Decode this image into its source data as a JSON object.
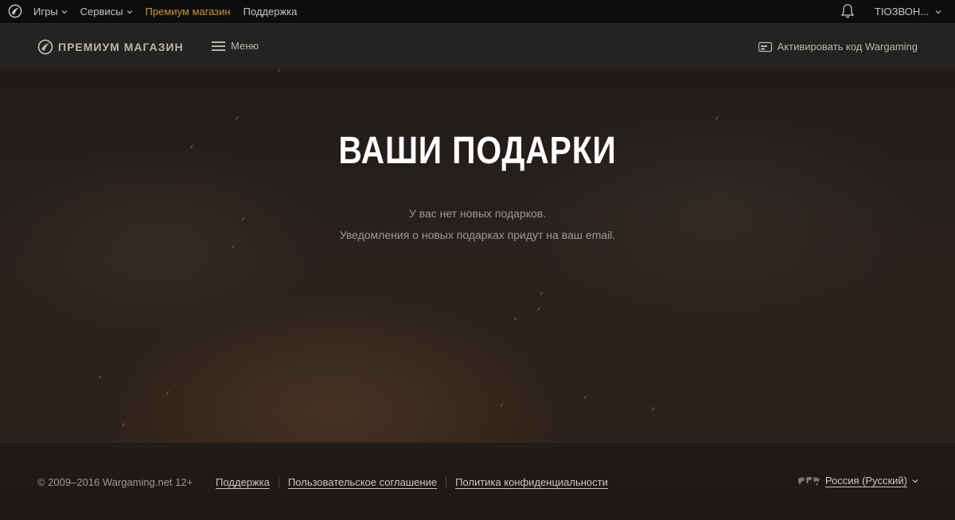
{
  "topbar": {
    "nav": [
      {
        "label": "Игры",
        "dropdown": true
      },
      {
        "label": "Сервисы",
        "dropdown": true
      },
      {
        "label": "Премиум магазин",
        "dropdown": false,
        "active": true
      },
      {
        "label": "Поддержка",
        "dropdown": false
      }
    ],
    "user": "ТІОЗВОН...",
    "icons": {
      "logo": "wargaming-logo-icon",
      "notifications": "bell-icon",
      "user_dropdown": "chevron-down-icon"
    }
  },
  "header": {
    "brand": "ПРЕМИУМ МАГАЗИН",
    "menu_label": "Меню",
    "activate_label": "Активировать код Wargaming"
  },
  "hero": {
    "title": "ВАШИ ПОДАРКИ",
    "line1": "У вас нет новых подарков.",
    "line2": "Уведомления о новых подарках придут на ваш email."
  },
  "footer": {
    "copyright": "© 2009–2016 Wargaming.net 12+",
    "links": [
      "Поддержка",
      "Пользовательское соглашение",
      "Политика конфиденциальности"
    ],
    "language": "Россия (Русский)"
  },
  "colors": {
    "accent": "#c8963c",
    "background": "#1a1716",
    "title": "#ffffff"
  }
}
